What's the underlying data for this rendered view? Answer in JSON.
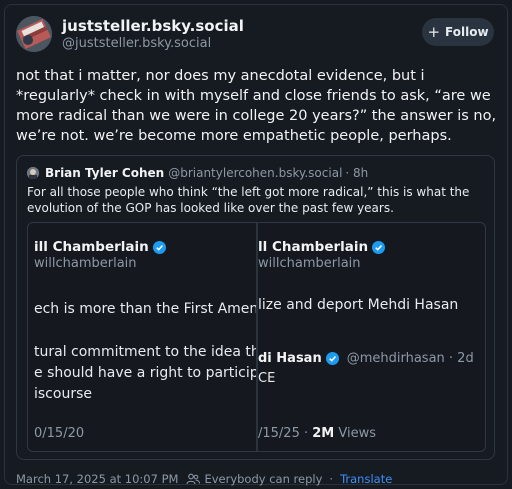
{
  "post": {
    "author_name": "juststeller.bsky.social",
    "author_handle": "@juststeller.bsky.social",
    "follow_label": "Follow",
    "text": "not that i matter, nor does my anecdotal evidence, but i *regularly* check in with myself and close friends to ask, “are we more radical than we were in college 20 years?” the answer is no, we’re not. we’re become more empathetic people, perhaps.",
    "timestamp": "March 17, 2025 at 10:07 PM",
    "reply_setting": "Everybody can reply",
    "separator": "·",
    "translate_label": "Translate"
  },
  "quote": {
    "author_name": "Brian Tyler Cohen",
    "author_handle": "@briantylercohen.bsky.social",
    "time": "· 8h",
    "text": "For all those people who think “the left got more radical,” this is what the evolution of the GOP has looked like over the past few years.",
    "left_panel": {
      "name": "ill Chamberlain",
      "handle": "willchamberlain",
      "line1": "ech is more than the First Amendm",
      "line2": "tural commitment to the idea that",
      "line3": "e should have a right to participate",
      "line4": "iscourse",
      "date": "0/15/20"
    },
    "right_panel": {
      "name": "ll Chamberlain",
      "handle": "willchamberlain",
      "line1": "lize and deport Mehdi Hasan",
      "sub_name": "di Hasan",
      "sub_handle": "@mehdirhasan · 2d",
      "sub_text": "CE",
      "date": "/15/25 · ",
      "views": "2M",
      "views_label": " Views"
    }
  },
  "colors": {
    "background": "#161b22",
    "accent": "#3e8ef7",
    "verified": "#1d9bf0"
  }
}
